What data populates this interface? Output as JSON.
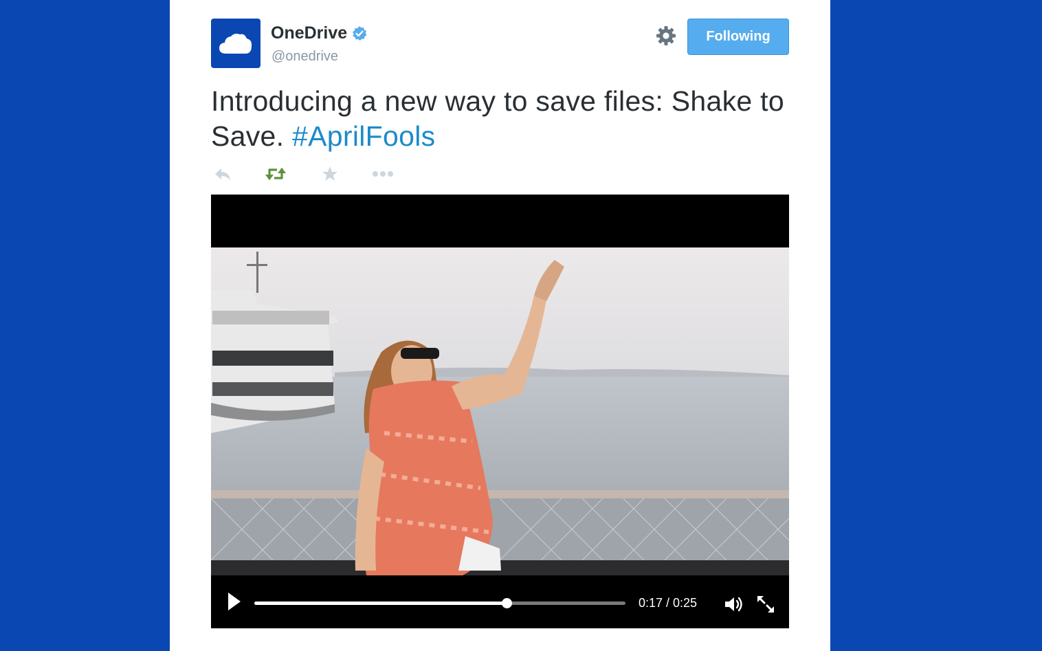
{
  "account": {
    "display_name": "OneDrive",
    "handle": "@onedrive",
    "verified": true,
    "avatar_icon": "cloud-icon"
  },
  "header": {
    "follow_label": "Following"
  },
  "tweet": {
    "text": "Introducing a new way to save files: Shake to Save.",
    "hashtag": "#AprilFools"
  },
  "actions": {
    "reply_icon": "reply-icon",
    "retweet_icon": "retweet-icon",
    "favorite_icon": "star-icon",
    "more_icon": "more-icon"
  },
  "video": {
    "current_time": "0:17",
    "duration": "0:25",
    "time_label": "0:17 / 0:25",
    "progress_fraction": 0.68
  },
  "colors": {
    "page_background": "#0a47b3",
    "accent": "#55acee",
    "hashtag": "#1b8bc9",
    "retweet_active": "#5c913b"
  }
}
